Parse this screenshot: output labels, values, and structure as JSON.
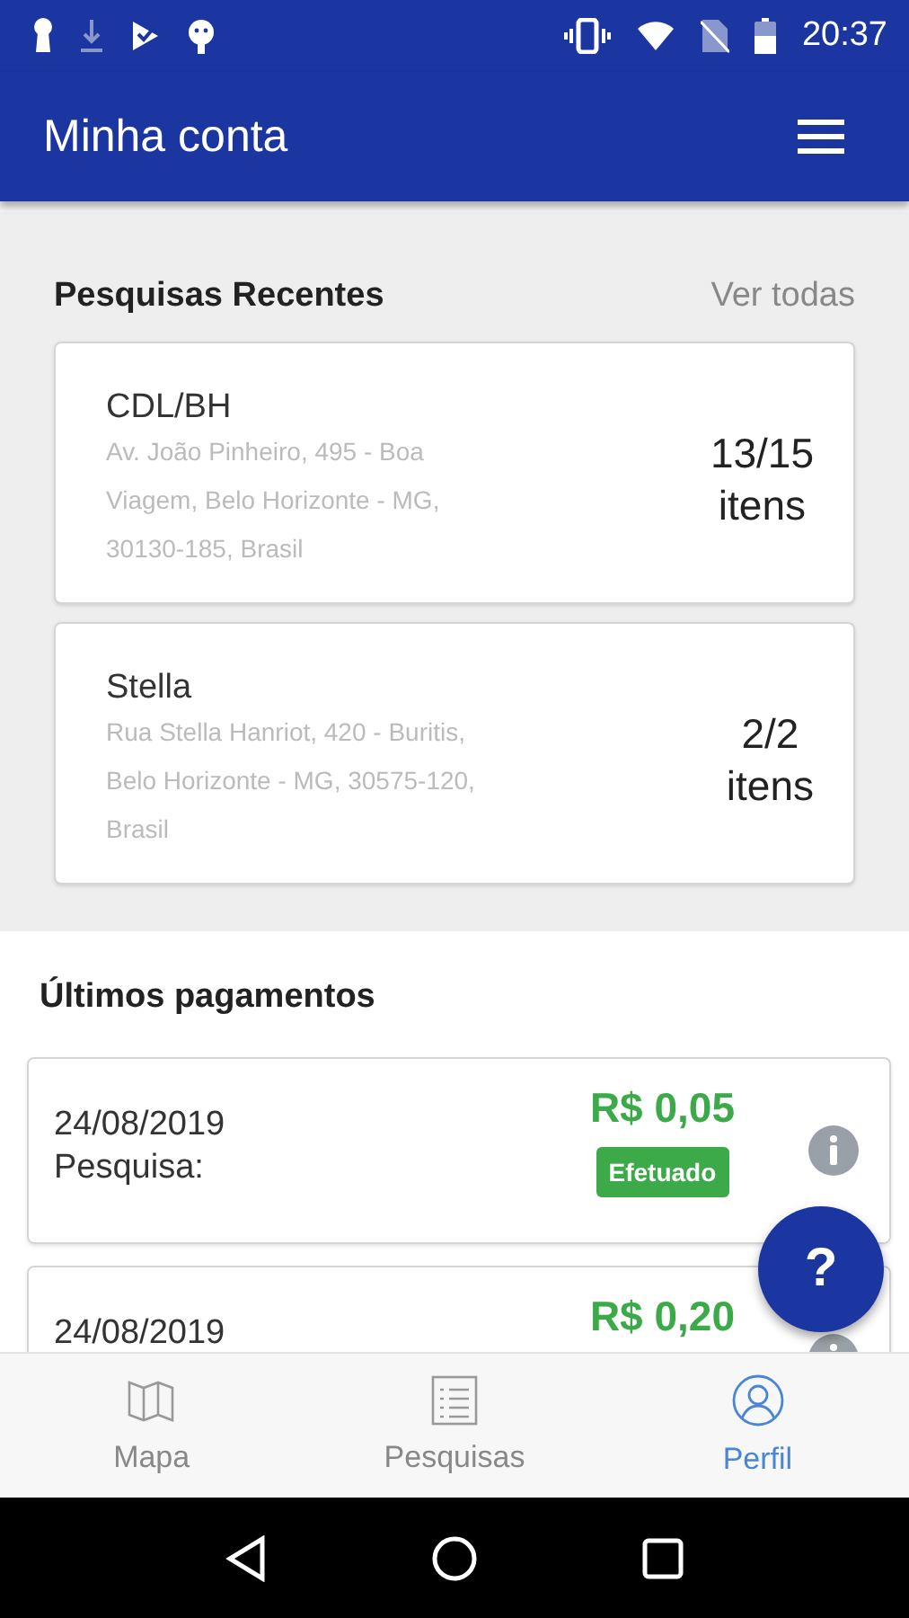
{
  "status_bar": {
    "time": "20:37"
  },
  "app_bar": {
    "title": "Minha conta"
  },
  "recent_searches": {
    "title": "Pesquisas Recentes",
    "link": "Ver todas",
    "items": [
      {
        "name": "CDL/BH",
        "address": "Av. João Pinheiro, 495 - Boa Viagem, Belo Horizonte - MG, 30130-185, Brasil",
        "count": "13/15",
        "unit": "itens"
      },
      {
        "name": "Stella",
        "address": "Rua Stella Hanriot, 420 - Buritis, Belo Horizonte - MG, 30575-120, Brasil",
        "count": "2/2",
        "unit": "itens"
      }
    ]
  },
  "payments": {
    "title": "Últimos pagamentos",
    "items": [
      {
        "date": "24/08/2019",
        "label": "Pesquisa:",
        "amount": "R$ 0,05",
        "status": "Efetuado"
      },
      {
        "date": "24/08/2019",
        "amount": "R$ 0,20"
      }
    ]
  },
  "help_button": {
    "label": "?"
  },
  "bottom_nav": [
    {
      "label": "Mapa",
      "selected": false
    },
    {
      "label": "Pesquisas",
      "selected": false
    },
    {
      "label": "Perfil",
      "selected": true
    }
  ]
}
